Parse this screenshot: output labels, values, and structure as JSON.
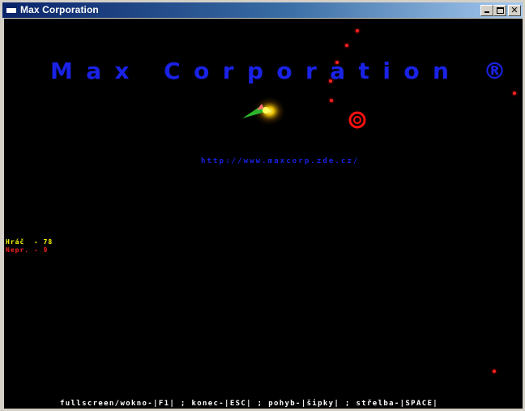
{
  "window": {
    "title": "Max Corporation",
    "buttons": {
      "minimize": "minimize",
      "maximize": "maximize",
      "close": "✕"
    }
  },
  "game": {
    "logo": "Max Corporation ®",
    "url": "http://www.maxcorp.zde.cz/",
    "stats": {
      "player": "Hráč  - 78",
      "enemy": "Nepr. - 9"
    },
    "controls": "fullscreen/wokno-|F1| ; konec-|ESC| ; pohyb-|šipky| ; střelba-|SPACE|",
    "colors": {
      "background": "#000000",
      "logo": "#1a22e6",
      "player_stat": "#ffff00",
      "enemy_stat": "#ff2020",
      "controls": "#ffffff",
      "particles": "#ff2020"
    },
    "icons": [
      "player-ship-icon",
      "enemy-ring-icon",
      "red-particle-icon"
    ]
  }
}
